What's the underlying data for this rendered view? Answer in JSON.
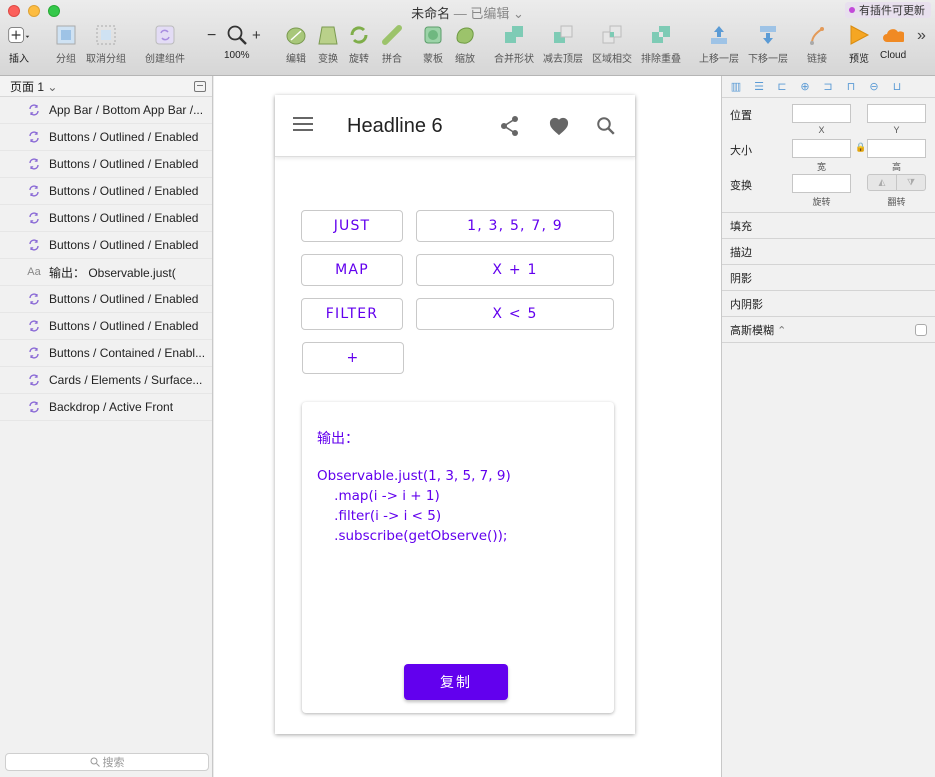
{
  "window": {
    "title": "未命名",
    "subtitle": "— 已编辑",
    "plugin_update": "有插件可更新"
  },
  "toolbar": {
    "insert": "插入",
    "group": "分组",
    "ungroup": "取消分组",
    "create_component": "创建组件",
    "zoom_minus": "−",
    "zoom_plus": "+",
    "zoom_level": "100%",
    "edit": "编辑",
    "transform": "变换",
    "rotate": "旋转",
    "flatten": "拼合",
    "mask": "蒙板",
    "scale": "缩放",
    "union": "合并形状",
    "subtract": "减去顶层",
    "intersect": "区域相交",
    "difference": "排除重叠",
    "forward": "上移一层",
    "backward": "下移一层",
    "link": "链接",
    "preview": "预览",
    "cloud": "Cloud",
    "more": "»"
  },
  "sidebar": {
    "page_label": "页面 1",
    "search_placeholder": "搜索",
    "layers": [
      {
        "name": "App Bar / Bottom App Bar /...",
        "icon": "symbol-icon"
      },
      {
        "name": "Buttons / Outlined / Enabled",
        "icon": "symbol-icon"
      },
      {
        "name": "Buttons / Outlined / Enabled",
        "icon": "symbol-icon"
      },
      {
        "name": "Buttons / Outlined / Enabled",
        "icon": "symbol-icon"
      },
      {
        "name": "Buttons / Outlined / Enabled",
        "icon": "symbol-icon"
      },
      {
        "name": "Buttons / Outlined / Enabled",
        "icon": "symbol-icon"
      },
      {
        "name": "输出：  Observable.just(",
        "icon": "text-icon"
      },
      {
        "name": "Buttons / Outlined / Enabled",
        "icon": "symbol-icon"
      },
      {
        "name": "Buttons / Outlined / Enabled",
        "icon": "symbol-icon"
      },
      {
        "name": "Buttons / Contained / Enabl...",
        "icon": "symbol-icon"
      },
      {
        "name": "Cards / Elements / Surface...",
        "icon": "symbol-icon"
      },
      {
        "name": "Backdrop / Active Front",
        "icon": "symbol-icon"
      }
    ]
  },
  "artboard": {
    "headline": "Headline 6",
    "buttons": {
      "just": "JUST",
      "just_args": "1,  3,  5,  7,  9",
      "map": "MAP",
      "map_args": "X + 1",
      "filter": "FILTER",
      "filter_args": "X < 5",
      "add": "+"
    },
    "card": {
      "output_label": "输出：",
      "code_lines": [
        "Observable.just(1, 3, 5, 7, 9)",
        "    .map(i -> i + 1)",
        "    .filter(i -> i < 5)",
        "    .subscribe(getObserve());"
      ],
      "copy_button": "复制"
    }
  },
  "inspector": {
    "position": "位置",
    "x": "X",
    "y": "Y",
    "size": "大小",
    "width": "宽",
    "height": "高",
    "transform": "变换",
    "rotate": "旋转",
    "flip": "翻转",
    "fill": "填充",
    "border": "描边",
    "shadow": "阴影",
    "inner_shadow": "内阴影",
    "blur": "高斯模糊"
  },
  "colors": {
    "accent": "#6200ee",
    "symbol_icon": "#8b6bd6"
  }
}
